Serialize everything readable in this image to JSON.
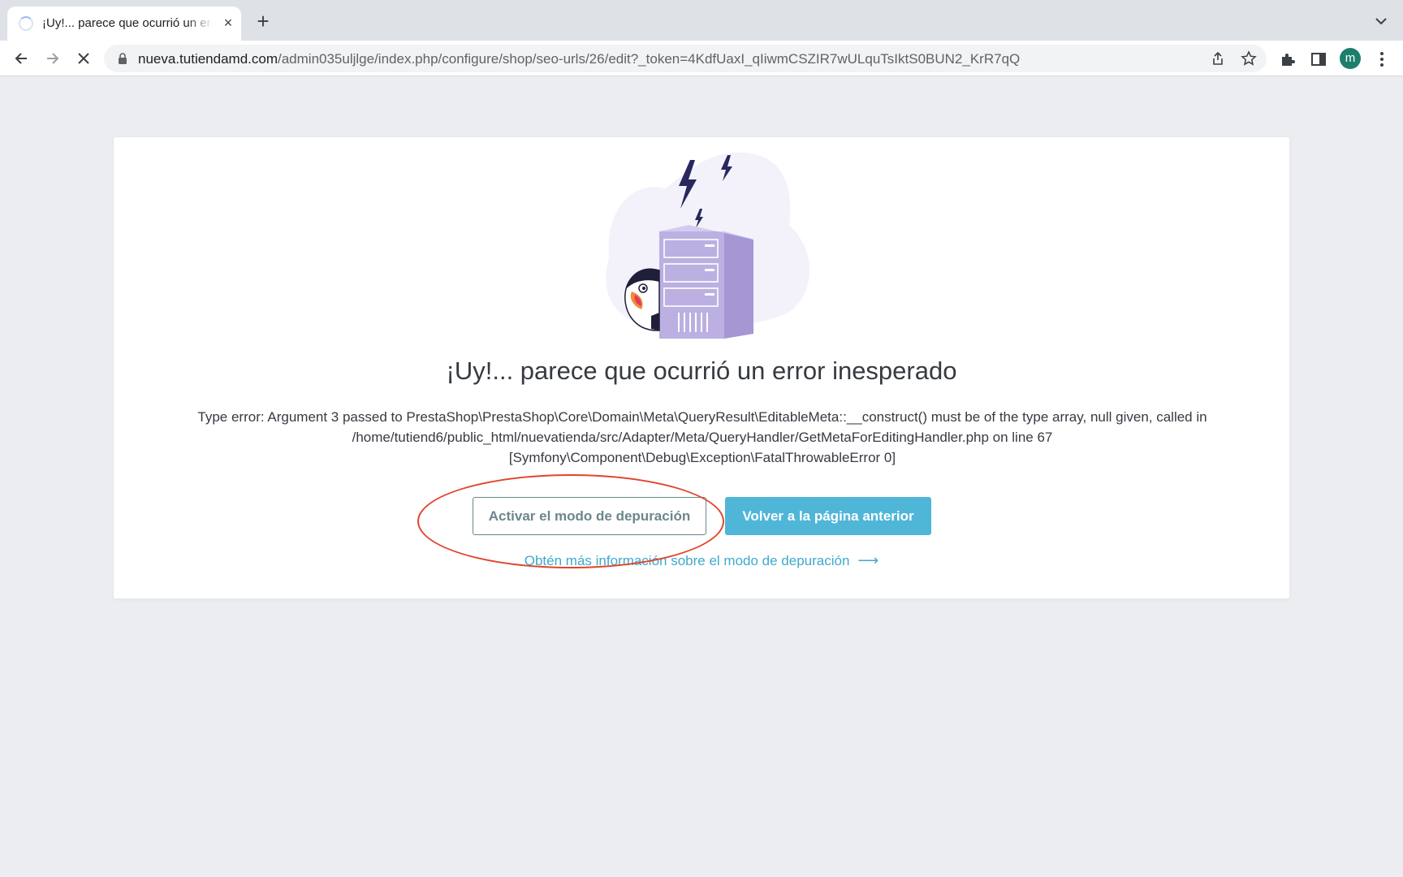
{
  "browser": {
    "tab": {
      "title": "¡Uy!... parece que ocurrió un error inesperado"
    },
    "address": {
      "host": "nueva.tutiendamd.com",
      "path": "/admin035uljlge/index.php/configure/shop/seo-urls/26/edit?_token=4KdfUaxI_qIiwmCSZIR7wULquTsIktS0BUN2_KrR7qQ"
    },
    "profile_initial": "m"
  },
  "page": {
    "title": "¡Uy!... parece que ocurrió un error inesperado",
    "error_lines": [
      "Type error: Argument 3 passed to PrestaShop\\PrestaShop\\Core\\Domain\\Meta\\QueryResult\\EditableMeta::__construct() must be of the type array, null given, called in",
      "/home/tutiend6/public_html/nuevatienda/src/Adapter/Meta/QueryHandler/GetMetaForEditingHandler.php on line 67",
      "[Symfony\\Component\\Debug\\Exception\\FatalThrowableError 0]"
    ],
    "debug_button": "Activar el modo de depuración",
    "back_button": "Volver a la página anterior",
    "more_info_link": "Obtén más información sobre el modo de depuración",
    "more_info_arrow": "⟶"
  },
  "colors": {
    "accent": "#25b9d7",
    "annotation": "#e0452c",
    "illustration": "#b7addf"
  }
}
